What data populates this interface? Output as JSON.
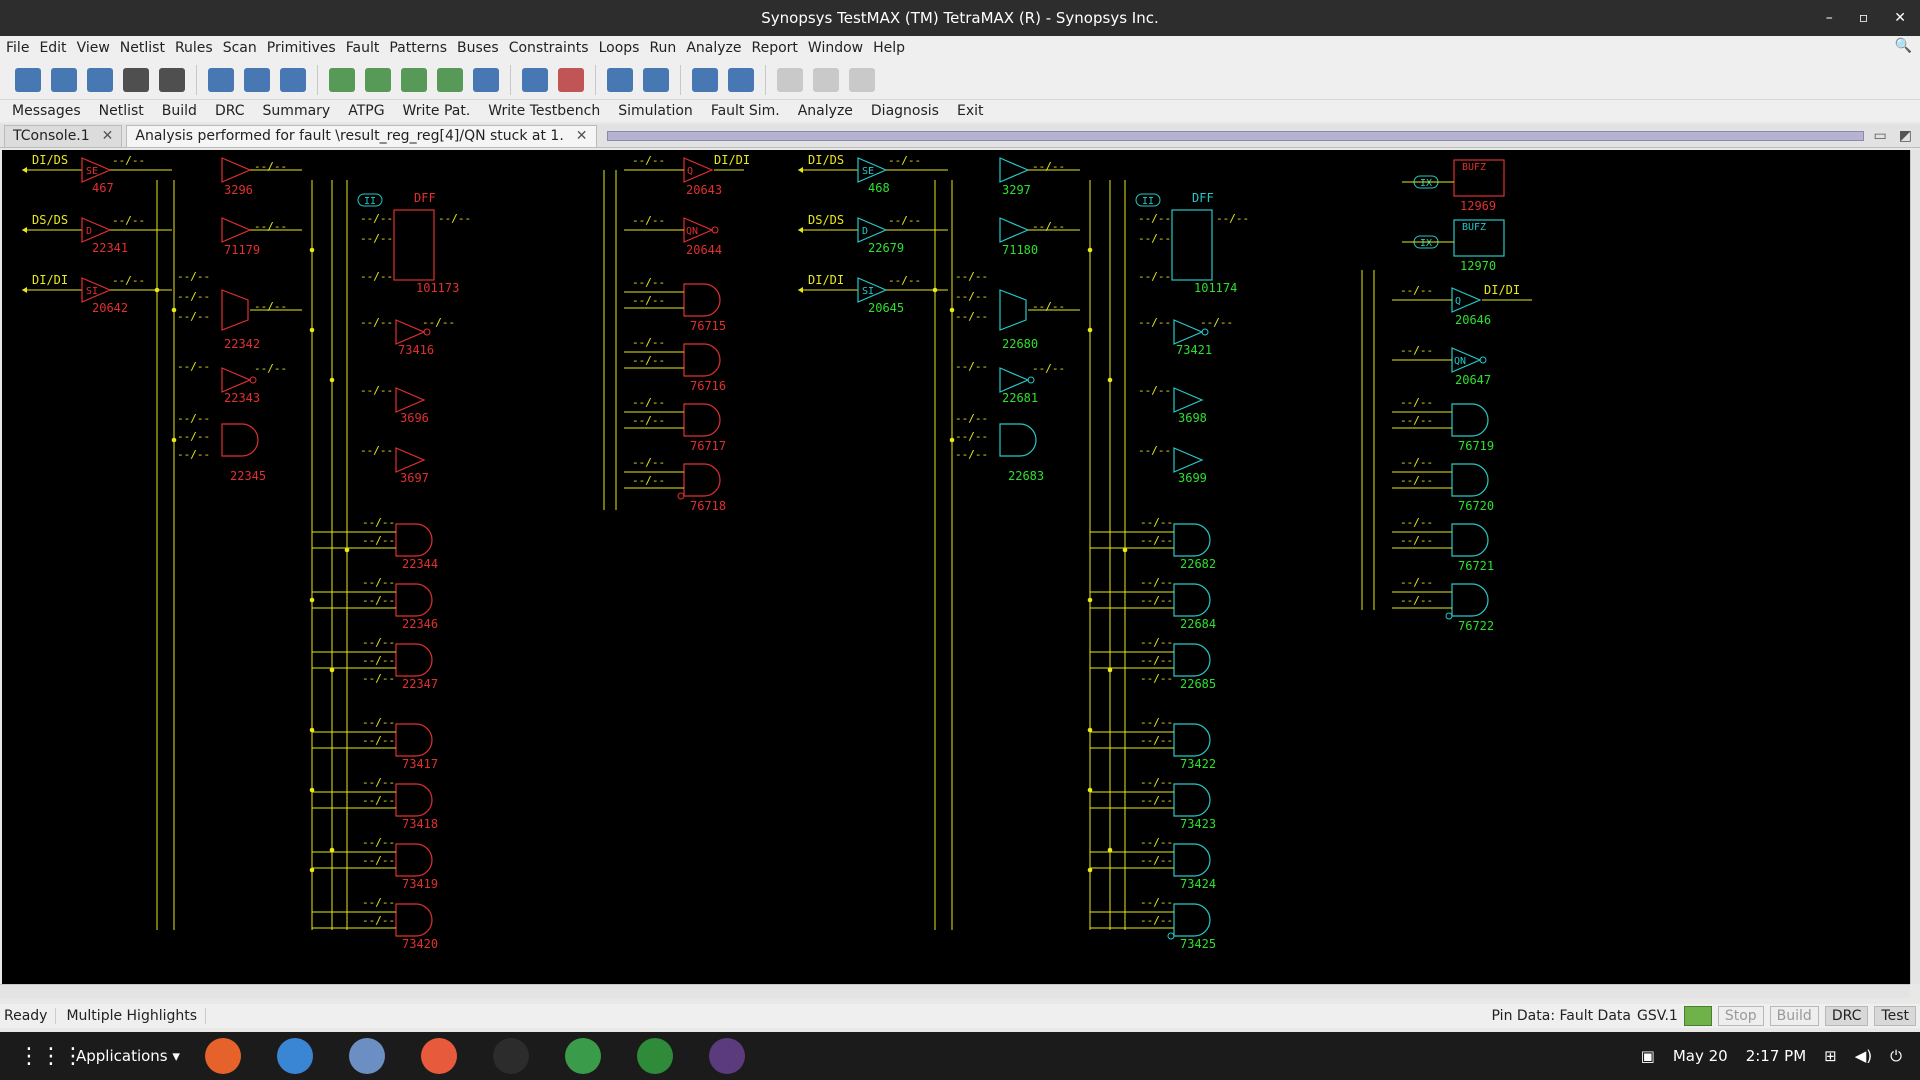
{
  "window": {
    "title": "Synopsys TestMAX (TM) TetraMAX (R) - Synopsys Inc.",
    "controls": [
      "–",
      "▫",
      "✕"
    ]
  },
  "menu": [
    "File",
    "Edit",
    "View",
    "Netlist",
    "Rules",
    "Scan",
    "Primitives",
    "Fault",
    "Patterns",
    "Buses",
    "Constraints",
    "Loops",
    "Run",
    "Analyze",
    "Report",
    "Window",
    "Help"
  ],
  "toolbar_icons": [
    {
      "name": "open-icon",
      "color": "#2a63a8"
    },
    {
      "name": "save-icon",
      "color": "#2a63a8"
    },
    {
      "name": "print-icon",
      "color": "#2a63a8"
    },
    {
      "name": "font-up-icon",
      "color": "#333333"
    },
    {
      "name": "font-down-icon",
      "color": "#333333"
    },
    {
      "name": "gate-icon",
      "color": "#2a63a8"
    },
    {
      "name": "bus-icon",
      "color": "#2a63a8"
    },
    {
      "name": "waveform-icon",
      "color": "#2a63a8"
    },
    {
      "name": "zoom-in-icon",
      "color": "#3c8a3c"
    },
    {
      "name": "zoom-out-icon",
      "color": "#3c8a3c"
    },
    {
      "name": "zoom-full-icon",
      "color": "#3c8a3c"
    },
    {
      "name": "zoom-fit-icon",
      "color": "#3c8a3c"
    },
    {
      "name": "zoom-area-icon",
      "color": "#2a63a8"
    },
    {
      "name": "refresh-icon",
      "color": "#2a63a8"
    },
    {
      "name": "trace-icon",
      "color": "#b83a3a"
    },
    {
      "name": "add-gate-icon",
      "color": "#2a63a8"
    },
    {
      "name": "remove-gate-icon",
      "color": "#2a63a8"
    },
    {
      "name": "find-icon",
      "color": "#2a63a8"
    },
    {
      "name": "print-schematic-icon",
      "color": "#2a63a8"
    },
    {
      "name": "disabled-a-icon",
      "color": "#aaaaaa"
    },
    {
      "name": "disabled-b-icon",
      "color": "#aaaaaa"
    },
    {
      "name": "disabled-c-icon",
      "color": "#aaaaaa"
    }
  ],
  "commands": [
    "Messages",
    "Netlist",
    "Build",
    "DRC",
    "Summary",
    "ATPG",
    "Write Pat.",
    "Write Testbench",
    "Simulation",
    "Fault Sim.",
    "Analyze",
    "Diagnosis",
    "Exit"
  ],
  "tabs": [
    {
      "label": "TConsole.1",
      "active": false
    },
    {
      "label": "Analysis performed for fault \\result_reg_reg[4]/QN stuck at 1.",
      "active": true
    }
  ],
  "schematic": {
    "wire_color": "#e8e81a",
    "red": "#e03030",
    "cyan": "#25c8c8",
    "id_red": "#e03030",
    "id_green": "#2ee02e",
    "pin_label": "--/--",
    "left_inputs": [
      {
        "label": "DI/DS",
        "pin": "SE",
        "id": "467"
      },
      {
        "label": "DS/DS",
        "pin": "D",
        "id": "22341"
      },
      {
        "label": "DI/DI",
        "pin": "SI",
        "id": "20642"
      }
    ],
    "right_inputs": [
      {
        "label": "DI/DS",
        "pin": "SE",
        "id": "468"
      },
      {
        "label": "DS/DS",
        "pin": "D",
        "id": "22679"
      },
      {
        "label": "DI/DI",
        "pin": "SI",
        "id": "20645"
      }
    ],
    "red_ids": {
      "buf_top": "3296",
      "buf_mid": "71179",
      "mux": "22342",
      "inv": "22343",
      "and": "22345",
      "dff": "101173",
      "q": "20643",
      "qn": "20644",
      "inv2": "73416",
      "b1": "3696",
      "b2": "3697",
      "ands_right": [
        "76715",
        "76716",
        "76717",
        "76718"
      ],
      "ands_col": [
        "22344",
        "22346",
        "22347",
        "73417",
        "73418",
        "73419",
        "73420"
      ]
    },
    "cyan_ids": {
      "buf_top": "3297",
      "buf_mid": "71180",
      "mux": "22680",
      "inv": "22681",
      "and": "22683",
      "dff": "101174",
      "q": "20646",
      "qn": "20647",
      "inv2": "73421",
      "b1": "3698",
      "b2": "3699",
      "ands_right": [
        "76719",
        "76720",
        "76721",
        "76722"
      ],
      "ands_col": [
        "22682",
        "22684",
        "22685",
        "73422",
        "73423",
        "73424",
        "73425"
      ],
      "bufz": [
        "12969",
        "12970"
      ]
    },
    "dff_label": "DFF",
    "bufz_label": "BUFZ",
    "q_pin": "Q",
    "qn_pin": "QN",
    "q_out_left": "DI/DI",
    "q_out_right": "DI/DI",
    "ii_label": "II",
    "ix_label": "IX"
  },
  "status": {
    "state": "Ready",
    "highlight": "Multiple Highlights",
    "pin_data": "Pin Data: Fault Data",
    "gsv": "GSV.1",
    "stop": "Stop",
    "build": "Build",
    "drc": "DRC",
    "test": "Test"
  },
  "taskbar": {
    "applications": "Applications ▾",
    "apps": [
      {
        "name": "firefox-icon",
        "color": "#e5632a"
      },
      {
        "name": "software-icon",
        "color": "#3a86d4"
      },
      {
        "name": "files-icon",
        "color": "#6b8fc2"
      },
      {
        "name": "help-icon",
        "color": "#e85a3c"
      },
      {
        "name": "terminal-icon",
        "color": "#2c2c2c"
      },
      {
        "name": "chrome-icon",
        "color": "#3a9c4a"
      },
      {
        "name": "vim-icon",
        "color": "#2f8a3a"
      },
      {
        "name": "tetramax-icon",
        "color": "#5b3a7e"
      }
    ],
    "date": "May 20",
    "time": "2:17 PM"
  }
}
